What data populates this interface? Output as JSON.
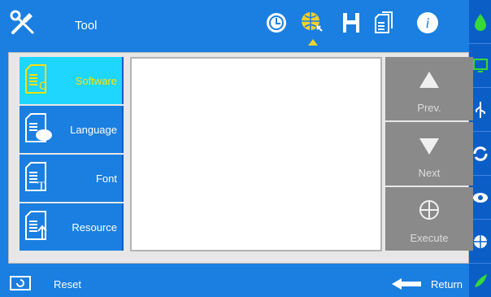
{
  "header": {
    "title": "Tool",
    "icons": [
      "wrench-screwdriver-icon",
      "clock-icon",
      "globe-update-icon",
      "save-disk-icon",
      "document-copy-icon",
      "info-icon"
    ]
  },
  "sidebar": {
    "items": [
      {
        "label": "Software",
        "selected": true,
        "icon": "document-csharp-icon"
      },
      {
        "label": "Language",
        "selected": false,
        "icon": "document-chat-icon"
      },
      {
        "label": "Font",
        "selected": false,
        "icon": "document-font-icon"
      },
      {
        "label": "Resource",
        "selected": false,
        "icon": "document-upload-icon"
      }
    ]
  },
  "nav": {
    "prev_label": "Prev.",
    "next_label": "Next",
    "execute_label": "Execute"
  },
  "footer": {
    "reset_label": "Reset",
    "return_label": "Return"
  },
  "rightbar": {
    "icons": [
      "ink-drop-icon",
      "monitor-icon",
      "usb-icon",
      "refresh-icon",
      "eye-icon",
      "globe-icon",
      "leaf-icon"
    ]
  },
  "colors": {
    "primary": "#1a7fe0",
    "selected": "#1fd6ff",
    "selected_text": "#ffe000",
    "disabled_button": "#8a8a8a"
  }
}
